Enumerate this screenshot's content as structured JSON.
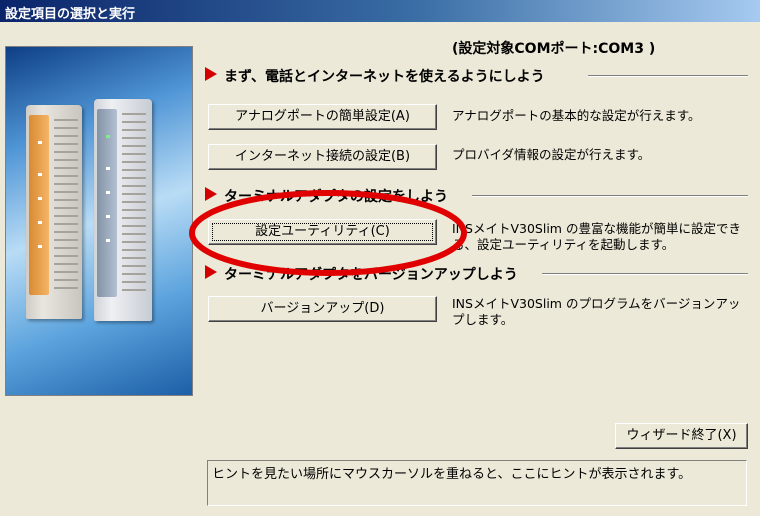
{
  "window": {
    "title": "設定項目の選択と実行",
    "titlebar_colors": [
      "#0a246a",
      "#a6caf0"
    ]
  },
  "port_label": "(設定対象COMポート:COM3 )",
  "sections": [
    {
      "title": "まず、電話とインターネットを使えるようにしよう",
      "buttons": [
        {
          "label": "アナログポートの簡単設定(A)",
          "description": "アナログポートの基本的な設定が行えます。"
        },
        {
          "label": "インターネット接続の設定(B)",
          "description": "プロバイダ情報の設定が行えます。"
        }
      ]
    },
    {
      "title": "ターミナルアダプタの設定をしよう",
      "buttons": [
        {
          "label": "設定ユーティリティ(C)",
          "description": "INSメイトV30Slim の豊富な機能が簡単に設定できる、設定ユーティリティを起動します。",
          "focused": true
        }
      ]
    },
    {
      "title": "ターミナルアダプタをバージョンアップしよう",
      "buttons": [
        {
          "label": "バージョンアップ(D)",
          "description": "INSメイトV30Slim のプログラムをバージョンアップします。"
        }
      ]
    }
  ],
  "exit_button": "ウィザード終了(X)",
  "hint_text": "ヒントを見たい場所にマウスカーソルを重ねると、ここにヒントが表示されます。",
  "colors": {
    "accent_arrow": "#d40000",
    "annotation_oval": "#e00000",
    "dialog_bg": "#ece9d8"
  },
  "icons": {
    "section_marker": "red-triangle-arrow",
    "product_photo": "terminal-adapter-devices"
  }
}
